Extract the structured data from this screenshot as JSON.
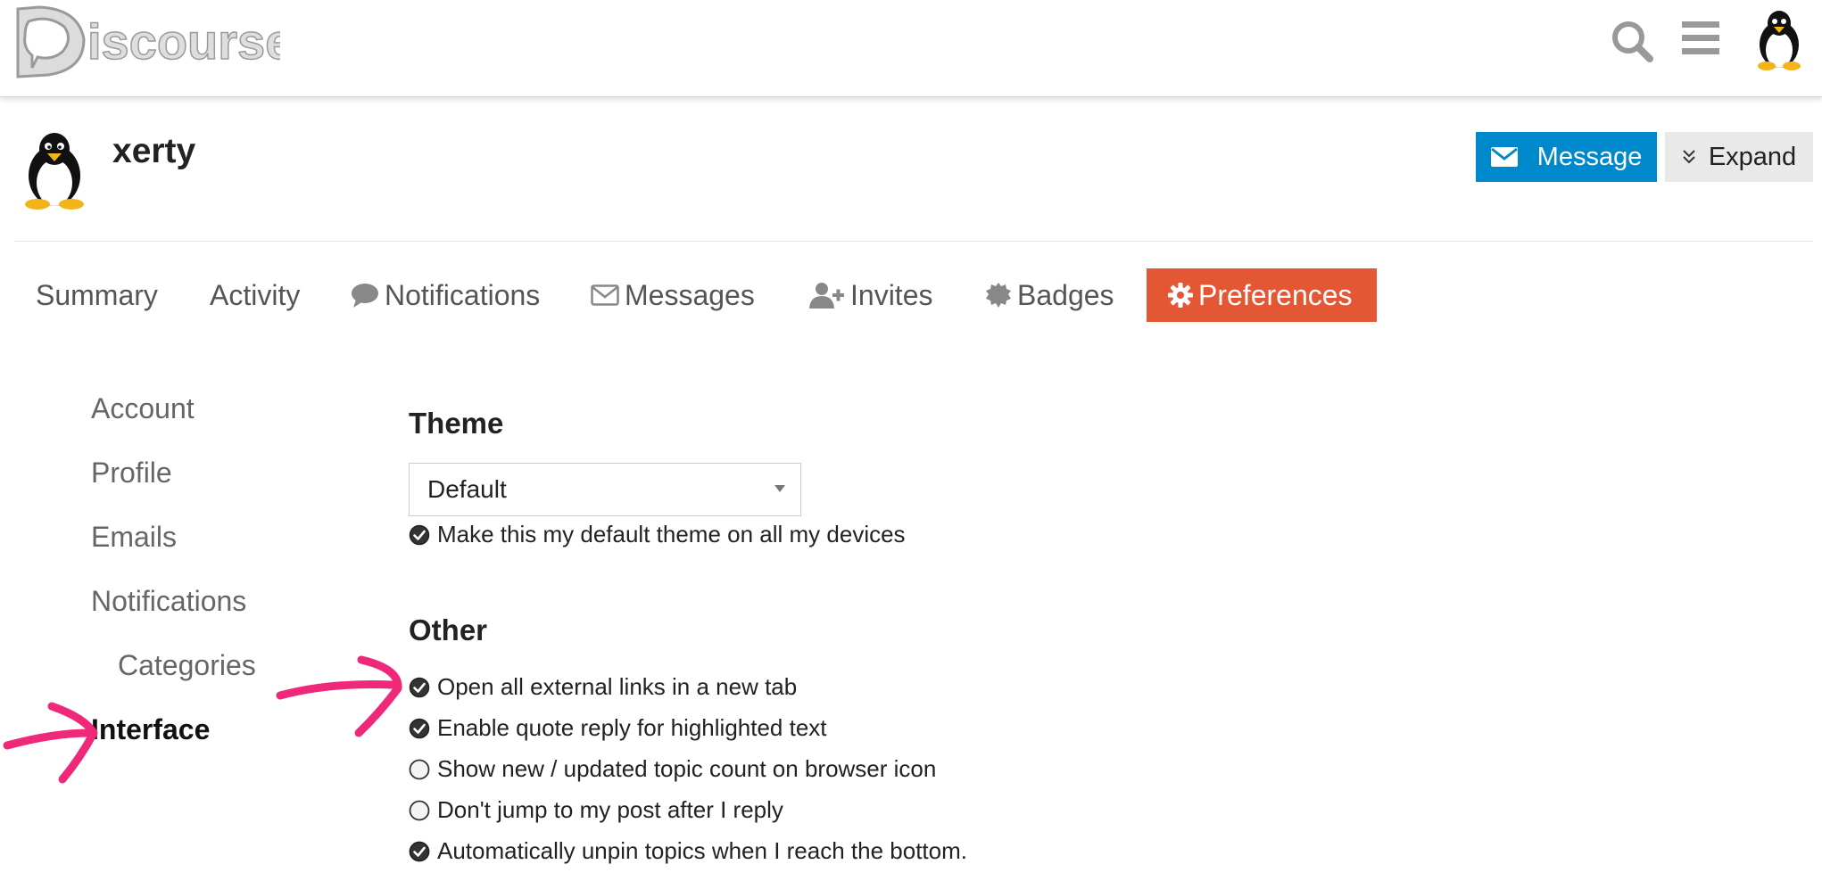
{
  "header": {
    "logo_text": "Discourse"
  },
  "user": {
    "username": "xerty",
    "message_label": "Message",
    "expand_label": "Expand"
  },
  "nav_tabs": [
    {
      "label": "Summary",
      "icon": "none",
      "active": false
    },
    {
      "label": "Activity",
      "icon": "none",
      "active": false
    },
    {
      "label": "Notifications",
      "icon": "comment-icon",
      "active": false
    },
    {
      "label": "Messages",
      "icon": "envelope-icon",
      "active": false
    },
    {
      "label": "Invites",
      "icon": "user-plus-icon",
      "active": false
    },
    {
      "label": "Badges",
      "icon": "certificate-icon",
      "active": false
    },
    {
      "label": "Preferences",
      "icon": "gear-icon",
      "active": true
    }
  ],
  "side_nav": [
    {
      "label": "Account",
      "active": false
    },
    {
      "label": "Profile",
      "active": false
    },
    {
      "label": "Emails",
      "active": false
    },
    {
      "label": "Notifications",
      "active": false
    },
    {
      "label": "Categories",
      "active": false,
      "sub": true
    },
    {
      "label": "Interface",
      "active": true
    }
  ],
  "theme": {
    "title": "Theme",
    "selected": "Default",
    "default_checkbox": {
      "label": "Make this my default theme on all my devices",
      "checked": true
    }
  },
  "other": {
    "title": "Other",
    "options": [
      {
        "label": "Open all external links in a new tab",
        "checked": true
      },
      {
        "label": "Enable quote reply for highlighted text",
        "checked": true
      },
      {
        "label": "Show new / updated topic count on browser icon",
        "checked": false
      },
      {
        "label": "Don't jump to my post after I reply",
        "checked": false
      },
      {
        "label": "Automatically unpin topics when I reach the bottom.",
        "checked": true
      }
    ]
  },
  "colors": {
    "primary_button": "#0088cc",
    "active_tab": "#e45735",
    "annotation_arrow": "#f0287a"
  }
}
